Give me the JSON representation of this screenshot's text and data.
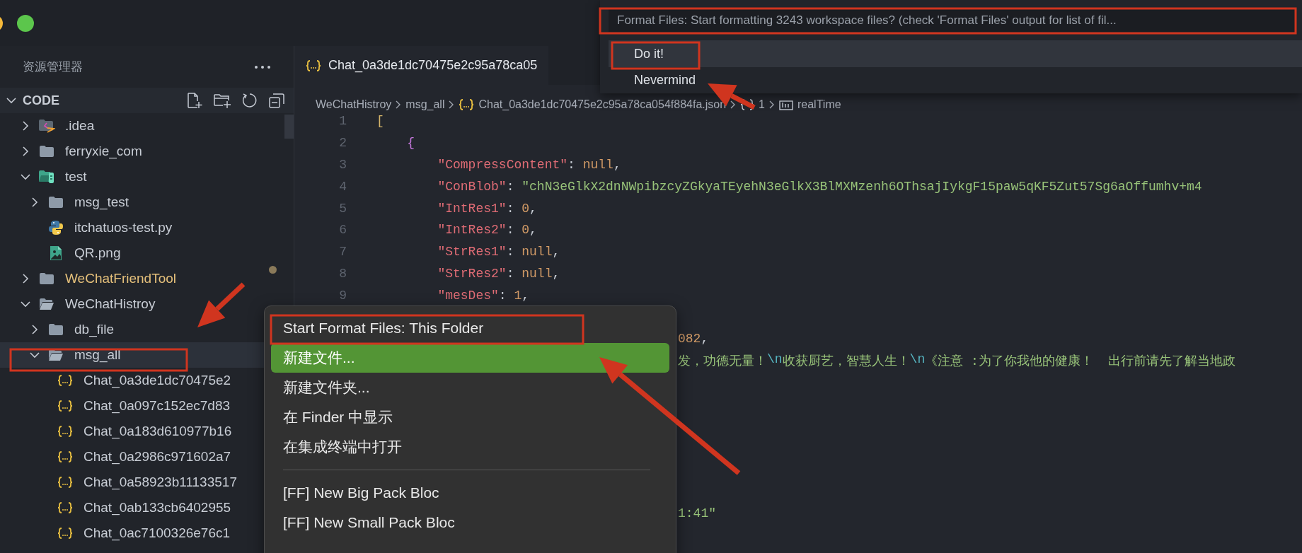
{
  "sidebar": {
    "title": "资源管理器",
    "workspace": {
      "label": "CODE",
      "expanded": true
    },
    "tree": [
      {
        "kind": "idea-folder",
        "label": ".idea",
        "expanded": false,
        "selected": false,
        "modified": false
      },
      {
        "kind": "folder",
        "label": "ferryxie_com",
        "expanded": false,
        "selected": false,
        "modified": false
      },
      {
        "kind": "test-folder",
        "label": "test",
        "expanded": true,
        "selected": false,
        "modified": false,
        "children": [
          {
            "kind": "folder",
            "label": "msg_test",
            "expanded": false,
            "selected": false,
            "modified": false
          },
          {
            "kind": "python",
            "label": "itchatuos-test.py",
            "selected": false,
            "modified": false
          },
          {
            "kind": "image",
            "label": "QR.png",
            "selected": false,
            "modified": false
          }
        ]
      },
      {
        "kind": "folder",
        "label": "WeChatFriendTool",
        "expanded": false,
        "selected": false,
        "modified": true
      },
      {
        "kind": "folder",
        "label": "WeChatHistroy",
        "expanded": true,
        "selected": false,
        "modified": false,
        "children": [
          {
            "kind": "folder",
            "label": "db_file",
            "expanded": false,
            "selected": false,
            "modified": false
          },
          {
            "kind": "folder",
            "label": "msg_all",
            "expanded": true,
            "selected": true,
            "modified": false,
            "children": [
              {
                "kind": "json",
                "label": "Chat_0a3de1dc70475e2",
                "selected": false,
                "modified": false
              },
              {
                "kind": "json",
                "label": "Chat_0a097c152ec7d83",
                "selected": false,
                "modified": false
              },
              {
                "kind": "json",
                "label": "Chat_0a183d610977b16",
                "selected": false,
                "modified": false
              },
              {
                "kind": "json",
                "label": "Chat_0a2986c971602a7",
                "selected": false,
                "modified": false
              },
              {
                "kind": "json",
                "label": "Chat_0a58923b11133517",
                "selected": false,
                "modified": false
              },
              {
                "kind": "json",
                "label": "Chat_0ab133cb6402955",
                "selected": false,
                "modified": false
              },
              {
                "kind": "json",
                "label": "Chat_0ac7100326e76c1",
                "selected": false,
                "modified": false
              }
            ]
          }
        ]
      }
    ]
  },
  "editor": {
    "tabs": [
      {
        "label": "Chat_0a3de1dc70475e2c95a78ca05",
        "selected": true
      }
    ],
    "breadcrumb": [
      {
        "kind": "folder",
        "label": "WeChatHistroy"
      },
      {
        "kind": "folder",
        "label": "msg_all"
      },
      {
        "kind": "json",
        "label": "Chat_0a3de1dc70475e2c95a78ca054f884fa.json"
      },
      {
        "kind": "object",
        "label": "1"
      },
      {
        "kind": "field",
        "label": "realTime"
      }
    ],
    "lines": [
      {
        "kind": "code",
        "number": "1",
        "tokens": [
          {
            "kind": "bracket",
            "text": "["
          }
        ]
      },
      {
        "kind": "code",
        "number": "2",
        "tokens": [
          {
            "kind": "brace",
            "text": "    {"
          }
        ]
      },
      {
        "kind": "code",
        "number": "3",
        "tokens": [
          {
            "kind": "key",
            "text": "        \"CompressContent\""
          },
          {
            "kind": "punct",
            "text": ": "
          },
          {
            "kind": "null",
            "text": "null"
          },
          {
            "kind": "punct",
            "text": ","
          }
        ]
      },
      {
        "kind": "code",
        "number": "4",
        "tokens": [
          {
            "kind": "key",
            "text": "        \"ConBlob\""
          },
          {
            "kind": "punct",
            "text": ": "
          },
          {
            "kind": "string",
            "text": "\"chN3eGlkX2dnNWpibzcyZGkyaTEyehN3eGlkX3BlMXMzenh6OThsajIykgF15paw5qKF5Zut57Sg6aOffumhv+m4"
          }
        ]
      },
      {
        "kind": "code",
        "number": "5",
        "tokens": [
          {
            "kind": "key",
            "text": "        \"IntRes1\""
          },
          {
            "kind": "punct",
            "text": ": "
          },
          {
            "kind": "number",
            "text": "0"
          },
          {
            "kind": "punct",
            "text": ","
          }
        ]
      },
      {
        "kind": "code",
        "number": "6",
        "tokens": [
          {
            "kind": "key",
            "text": "        \"IntRes2\""
          },
          {
            "kind": "punct",
            "text": ": "
          },
          {
            "kind": "number",
            "text": "0"
          },
          {
            "kind": "punct",
            "text": ","
          }
        ]
      },
      {
        "kind": "code",
        "number": "7",
        "tokens": [
          {
            "kind": "key",
            "text": "        \"StrRes1\""
          },
          {
            "kind": "punct",
            "text": ": "
          },
          {
            "kind": "null",
            "text": "null"
          },
          {
            "kind": "punct",
            "text": ","
          }
        ]
      },
      {
        "kind": "code",
        "number": "8",
        "tokens": [
          {
            "kind": "key",
            "text": "        \"StrRes2\""
          },
          {
            "kind": "punct",
            "text": ": "
          },
          {
            "kind": "null",
            "text": "null"
          },
          {
            "kind": "punct",
            "text": ","
          }
        ]
      },
      {
        "kind": "code",
        "number": "9",
        "tokens": [
          {
            "kind": "key",
            "text": "        \"mesDes\""
          },
          {
            "kind": "punct",
            "text": ": "
          },
          {
            "kind": "number",
            "text": "1"
          },
          {
            "kind": "punct",
            "text": ","
          }
        ]
      },
      {
        "kind": "hidden"
      },
      {
        "kind": "fragment",
        "tokens": [
          {
            "kind": "number",
            "text": "082"
          },
          {
            "kind": "punct",
            "text": ","
          }
        ]
      },
      {
        "kind": "fragment",
        "tokens": [
          {
            "kind": "string",
            "text": "发，功德无量！"
          },
          {
            "kind": "escape",
            "text": "\\n"
          },
          {
            "kind": "string",
            "text": "收获厨艺，智慧人生！"
          },
          {
            "kind": "escape",
            "text": "\\n"
          },
          {
            "kind": "string",
            "text": "《注意 :为了你我他的健康！  出行前请先了解当地政"
          }
        ]
      },
      {
        "kind": "hidden"
      },
      {
        "kind": "hidden"
      },
      {
        "kind": "hidden"
      },
      {
        "kind": "hidden"
      },
      {
        "kind": "hidden"
      },
      {
        "kind": "hidden"
      },
      {
        "kind": "fragment",
        "tokens": [
          {
            "kind": "string",
            "text": "1:41\""
          }
        ]
      }
    ]
  },
  "quick_pick": {
    "placeholder": "Format Files: Start formatting 3243 workspace files? (check 'Format Files' output for list of fil...",
    "items": [
      {
        "label": "Do it!",
        "selected": true
      },
      {
        "label": "Nevermind",
        "selected": false
      }
    ]
  },
  "context_menu": {
    "items": [
      {
        "kind": "item",
        "label": "Start Format Files: This Folder",
        "selected": false
      },
      {
        "kind": "item",
        "label": "新建文件...",
        "selected": true
      },
      {
        "kind": "item",
        "label": "新建文件夹...",
        "selected": false
      },
      {
        "kind": "item",
        "label": "在 Finder 中显示",
        "selected": false
      },
      {
        "kind": "item",
        "label": "在集成终端中打开",
        "selected": false
      },
      {
        "kind": "separator"
      },
      {
        "kind": "item",
        "label": "[FF] New Big Pack Bloc",
        "selected": false
      },
      {
        "kind": "item",
        "label": "[FF] New Small Pack Bloc",
        "selected": false
      }
    ]
  }
}
